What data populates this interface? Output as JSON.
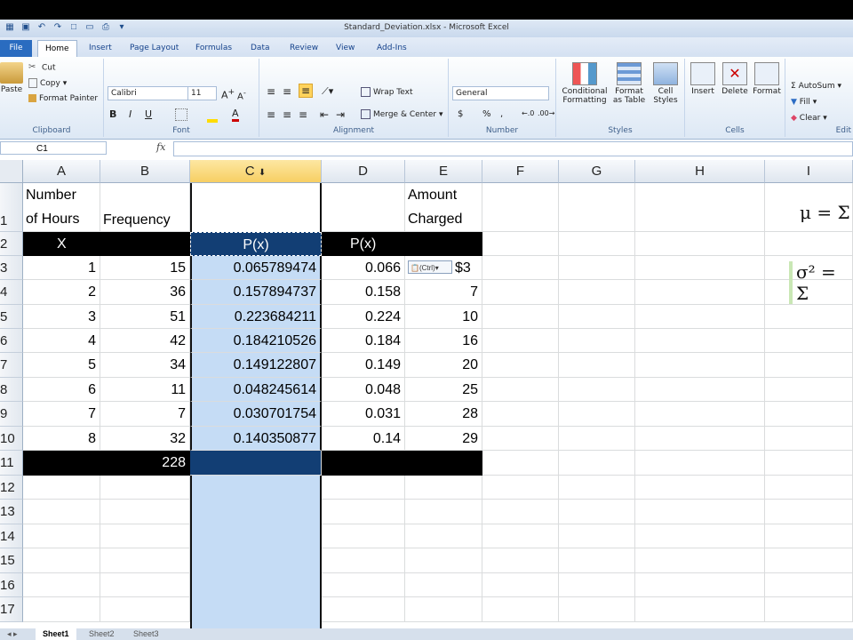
{
  "window": {
    "title": "Standard_Deviation.xlsx - Microsoft Excel"
  },
  "ribbon_tabs": [
    "File",
    "Home",
    "Insert",
    "Page Layout",
    "Formulas",
    "Data",
    "Review",
    "View",
    "Add-Ins"
  ],
  "clipboard": {
    "paste": "Paste",
    "cut": "Cut",
    "copy": "Copy",
    "format_painter": "Format Painter",
    "label": "Clipboard"
  },
  "font": {
    "name": "Calibri",
    "size": "11",
    "label": "Font",
    "bold": "B",
    "italic": "I",
    "underline": "U"
  },
  "alignment": {
    "wrap_text": "Wrap Text",
    "merge_center": "Merge & Center",
    "label": "Alignment"
  },
  "number": {
    "format": "General",
    "dollar": "$",
    "percent": "%",
    "comma": ",",
    "label": "Number"
  },
  "styles": {
    "conditional": "Conditional",
    "formatting": "Formatting",
    "format_as": "Format",
    "as_table": "as Table",
    "cell": "Cell",
    "cell_styles": "Styles",
    "label": "Styles"
  },
  "cells": {
    "insert": "Insert",
    "delete": "Delete",
    "format": "Format",
    "label": "Cells"
  },
  "editing": {
    "autosum": "AutoSum",
    "fill": "Fill",
    "clear": "Clear",
    "label": "Edit"
  },
  "formula_bar": {
    "name_box": "C1",
    "fx": "fx",
    "content": ""
  },
  "columns": [
    "A",
    "B",
    "C",
    "D",
    "E",
    "F",
    "G",
    "H",
    "I"
  ],
  "rows": [
    "1",
    "2",
    "3",
    "4",
    "5",
    "6",
    "7",
    "8",
    "9",
    "10",
    "11",
    "12",
    "13",
    "14",
    "15",
    "16",
    "17"
  ],
  "sheet": {
    "a1_line1": "Number",
    "a1_line2": "of Hours",
    "b1": "Frequency",
    "e1_line1": "Amount",
    "e1_line2": "Charged",
    "a2": "X",
    "c2": "P(x)",
    "d2": "P(x)",
    "b11": "228",
    "paste_tag": "(Ctrl)",
    "data": [
      {
        "x": "1",
        "freq": "15",
        "p": "0.065789474",
        "pr": "0.066",
        "amount": "$3"
      },
      {
        "x": "2",
        "freq": "36",
        "p": "0.157894737",
        "pr": "0.158",
        "amount": "7"
      },
      {
        "x": "3",
        "freq": "51",
        "p": "0.223684211",
        "pr": "0.224",
        "amount": "10"
      },
      {
        "x": "4",
        "freq": "42",
        "p": "0.184210526",
        "pr": "0.184",
        "amount": "16"
      },
      {
        "x": "5",
        "freq": "34",
        "p": "0.149122807",
        "pr": "0.149",
        "amount": "20"
      },
      {
        "x": "6",
        "freq": "11",
        "p": "0.048245614",
        "pr": "0.048",
        "amount": "25"
      },
      {
        "x": "7",
        "freq": "7",
        "p": "0.030701754",
        "pr": "0.031",
        "amount": "28"
      },
      {
        "x": "8",
        "freq": "32",
        "p": "0.140350877",
        "pr": "0.14",
        "amount": "29"
      }
    ]
  },
  "formulas": {
    "mu": "μ = Σ",
    "sigma": "σ² = Σ"
  },
  "sheet_tabs": [
    "Sheet1",
    "Sheet2",
    "Sheet3"
  ]
}
